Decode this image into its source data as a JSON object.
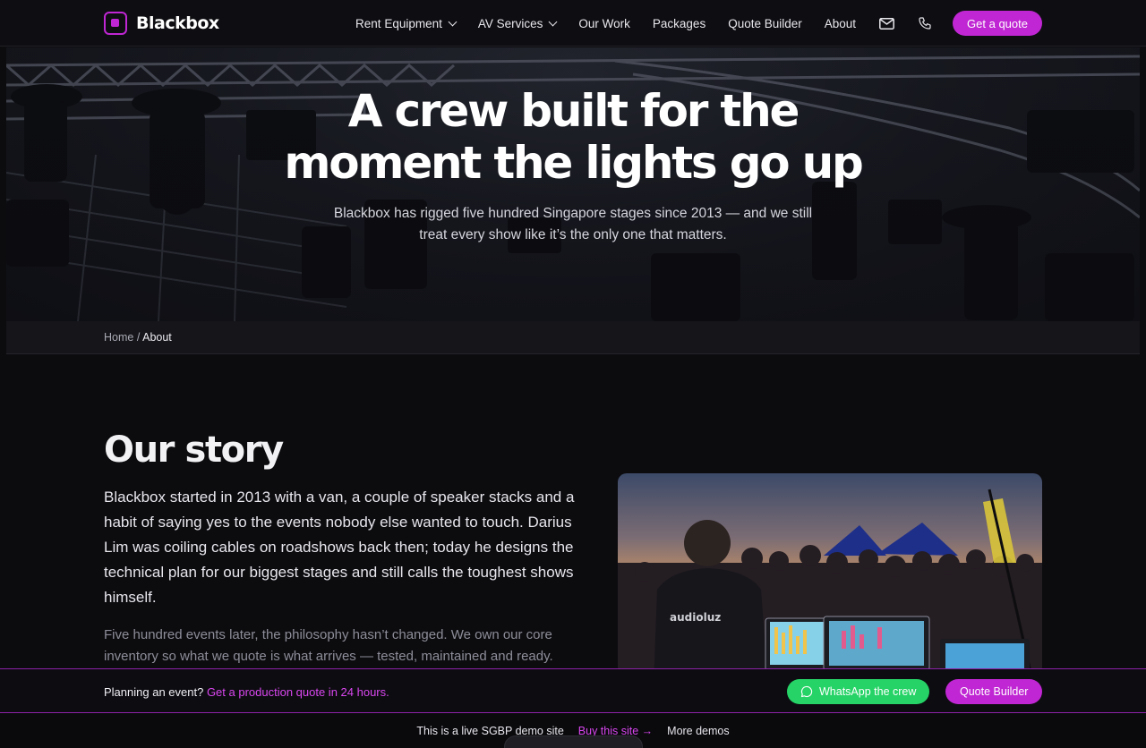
{
  "brand": {
    "name": "Blackbox",
    "accent": "#c026d3"
  },
  "nav": {
    "items": [
      {
        "label": "Rent Equipment",
        "dropdown": true
      },
      {
        "label": "AV Services",
        "dropdown": true
      },
      {
        "label": "Our Work",
        "dropdown": false
      },
      {
        "label": "Packages",
        "dropdown": false
      },
      {
        "label": "Quote Builder",
        "dropdown": false
      },
      {
        "label": "About",
        "dropdown": false
      }
    ],
    "icons": [
      "mail-icon",
      "phone-icon"
    ],
    "cta": "Get a quote"
  },
  "hero": {
    "title_line1": "A crew built for the",
    "title_line2": "moment the lights go up",
    "subtitle_line1": "Blackbox has rigged five hundred Singapore stages since 2013 — and we still",
    "subtitle_line2": "treat every show like it’s the only one that matters."
  },
  "breadcrumb": {
    "home": "Home",
    "separator": "/",
    "current": "About"
  },
  "story": {
    "title": "Our story",
    "paragraph1": "Blackbox started in 2013 with a van, a couple of speaker stacks and a habit of saying yes to the events nobody else wanted to touch. Darius Lim was coiling cables on roadshows back then; today he designs the technical plan for our biggest stages and still calls the toughest shows himself.",
    "paragraph2": "Five hundred events later, the philosophy hasn’t changed. We own our core inventory so what we quote is what arrives — tested, maintained and ready.",
    "photo_jacket_text": "audioluz"
  },
  "plan_bar": {
    "lead": "Planning an event?",
    "link": "Get a production quote in 24 hours.",
    "whatsapp": "WhatsApp the crew",
    "quote_builder": "Quote Builder",
    "whatsapp_color": "#25d366"
  },
  "demo_bar": {
    "text": "This is a live SGBP demo site",
    "buy": "Buy this site →",
    "more": "More demos"
  }
}
